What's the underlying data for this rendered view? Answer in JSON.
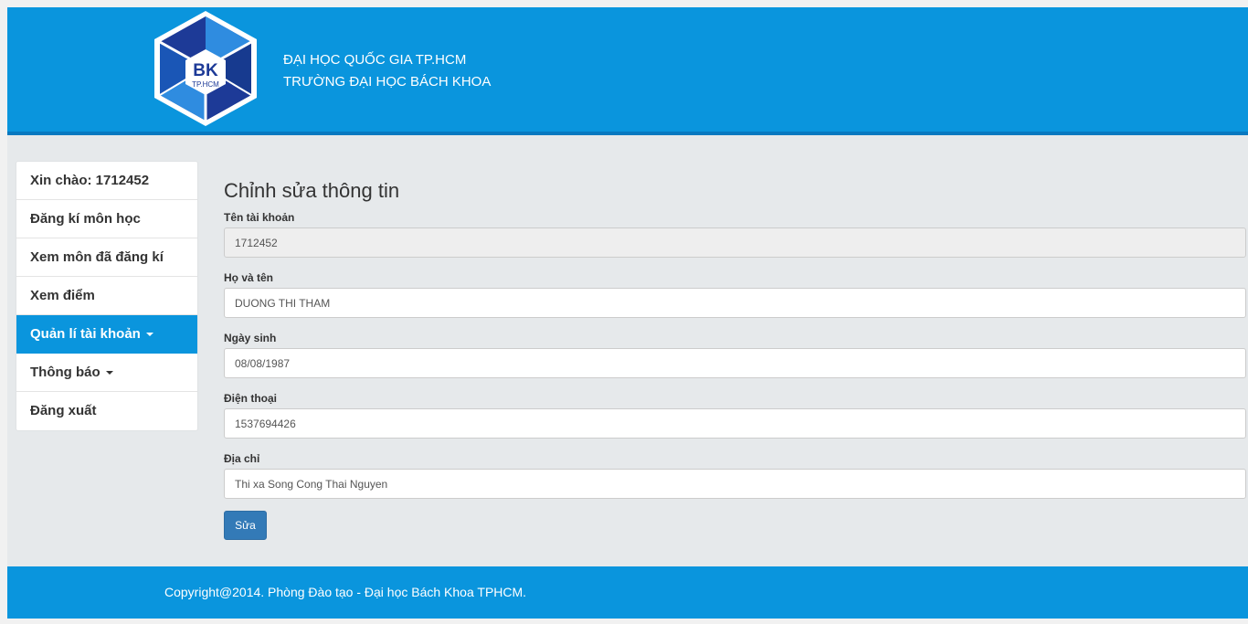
{
  "header": {
    "logo_text": "BK",
    "logo_subtext": "TP.HCM",
    "line1": "ĐẠI HỌC QUỐC GIA TP.HCM",
    "line2": "TRƯỜNG ĐẠI HỌC BÁCH KHOA",
    "colors": {
      "primary": "#0a95dd",
      "logo_dark": "#1d3a97",
      "logo_light": "#2f8ce0"
    }
  },
  "sidebar": {
    "items": [
      {
        "label": "Xin chào: 1712452",
        "active": false
      },
      {
        "label": "Đăng kí môn học",
        "active": false
      },
      {
        "label": "Xem môn đã đăng kí",
        "active": false
      },
      {
        "label": "Xem điểm",
        "active": false
      },
      {
        "label": "Quản lí tài khoản",
        "active": true,
        "caret": "caret-down-icon"
      },
      {
        "label": "Thông báo",
        "active": false,
        "caret": "caret-down-icon"
      },
      {
        "label": "Đăng xuất",
        "active": false
      }
    ]
  },
  "form": {
    "title": "Chỉnh sửa thông tin",
    "fields": {
      "username": {
        "label": "Tên tài khoản",
        "value": "1712452",
        "readonly": true
      },
      "fullname": {
        "label": "Họ và tên",
        "value": "DUONG THI THAM"
      },
      "birthday": {
        "label": "Ngày sinh",
        "value": "08/08/1987"
      },
      "phone": {
        "label": "Điện thoại",
        "value": "1537694426"
      },
      "address": {
        "label": "Địa chỉ",
        "value": "Thi xa Song Cong Thai Nguyen"
      }
    },
    "submit_label": "Sửa",
    "submit_color": "#337ab7"
  },
  "footer": {
    "text": "Copyright@2014. Phòng Đào tạo - Đại học Bách Khoa TPHCM."
  }
}
